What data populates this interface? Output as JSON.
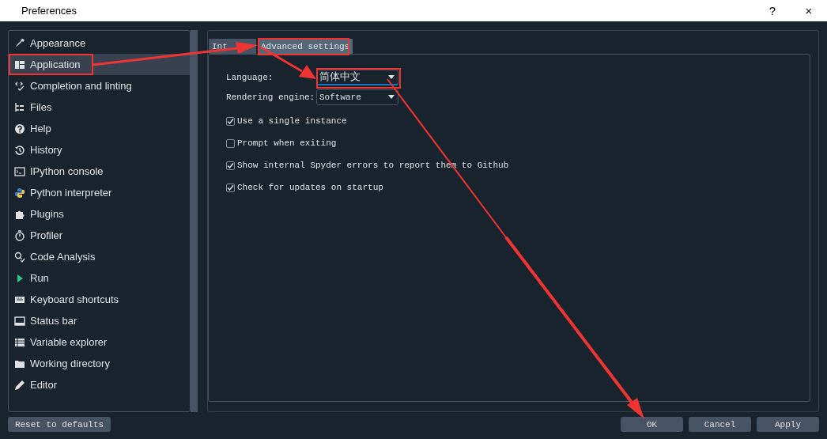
{
  "window": {
    "title": "Preferences",
    "help": "?",
    "close": "×"
  },
  "sidebar": {
    "items": [
      {
        "label": "Appearance",
        "selected": false
      },
      {
        "label": "Application",
        "selected": true
      },
      {
        "label": "Completion and linting",
        "selected": false
      },
      {
        "label": "Files",
        "selected": false
      },
      {
        "label": "Help",
        "selected": false
      },
      {
        "label": "History",
        "selected": false
      },
      {
        "label": "IPython console",
        "selected": false
      },
      {
        "label": "Python interpreter",
        "selected": false
      },
      {
        "label": "Plugins",
        "selected": false
      },
      {
        "label": "Profiler",
        "selected": false
      },
      {
        "label": "Code Analysis",
        "selected": false
      },
      {
        "label": "Run",
        "selected": false
      },
      {
        "label": "Keyboard shortcuts",
        "selected": false
      },
      {
        "label": "Status bar",
        "selected": false
      },
      {
        "label": "Variable explorer",
        "selected": false
      },
      {
        "label": "Working directory",
        "selected": false
      },
      {
        "label": "Editor",
        "selected": false
      }
    ]
  },
  "tabs": [
    {
      "label": "Int",
      "selected": false
    },
    {
      "label": "Advanced settings",
      "selected": true
    }
  ],
  "fields": [
    {
      "label": "Language:",
      "value": "简体中文",
      "focused": true
    },
    {
      "label": "Rendering engine:",
      "value": "Software",
      "focused": false
    }
  ],
  "checkboxes": [
    {
      "label": "Use a single instance",
      "checked": true
    },
    {
      "label": "Prompt when exiting",
      "checked": false
    },
    {
      "label": "Show internal Spyder errors to report them to Github",
      "checked": true
    },
    {
      "label": "Check for updates on startup",
      "checked": true
    }
  ],
  "reset_button": "Reset to defaults",
  "buttons": [
    "OK",
    "Cancel",
    "Apply"
  ]
}
